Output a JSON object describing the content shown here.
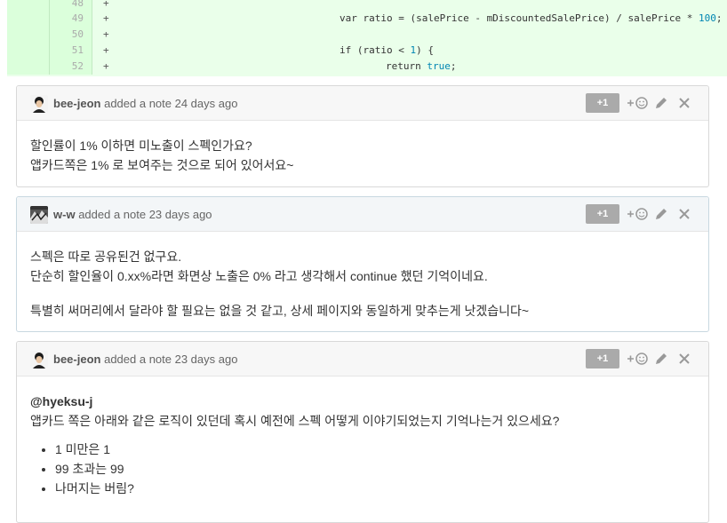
{
  "diff": {
    "rows": [
      {
        "line": "48",
        "sign": "+",
        "code": ""
      },
      {
        "line": "49",
        "sign": "+",
        "code_parts": [
          "var ratio = (salePrice - mDiscountedSalePrice) / salePrice * ",
          "100",
          ";"
        ]
      },
      {
        "line": "50",
        "sign": "+",
        "code": ""
      },
      {
        "line": "51",
        "sign": "+",
        "code_parts": [
          "if (ratio < ",
          "1",
          ") {"
        ]
      },
      {
        "line": "52",
        "sign": "+",
        "code_parts": [
          "return ",
          "true",
          ";"
        ]
      }
    ]
  },
  "actions": {
    "plus_one": "+1"
  },
  "notes": [
    {
      "author": "bee-jeon",
      "meta": "added a note 24 days ago",
      "avatar_icon": "user-photo-avatar",
      "lines": [
        "할인률이 1% 이하면 미노출이 스펙인가요?",
        "앱카드쪽은 1% 로 보여주는 것으로 되어 있어서요~"
      ]
    },
    {
      "author": "w-w",
      "meta": "added a note 23 days ago",
      "avatar_icon": "user-photo-avatar",
      "lines": [
        "스펙은 따로 공유된건 없구요.",
        "단순히 할인율이 0.xx%라면 화면상 노출은 0% 라고 생각해서 continue 했던 기억이네요."
      ],
      "paragraph2": "특별히 써머리에서 달라야 할 필요는 없을 것 같고, 상세 페이지와 동일하게 맞추는게 낫겠습니다~"
    },
    {
      "author": "bee-jeon",
      "meta": "added a note 23 days ago",
      "avatar_icon": "user-photo-avatar",
      "mention": "@hyeksu-j",
      "line": "앱카드 쪽은 아래와 같은 로직이 있던데 혹시 예전에 스펙 어떻게 이야기되었는지 기억나는거 있으세요?",
      "bullets": [
        "1 미만은 1",
        "99 초과는 99",
        "나머지는 버림?"
      ]
    }
  ]
}
